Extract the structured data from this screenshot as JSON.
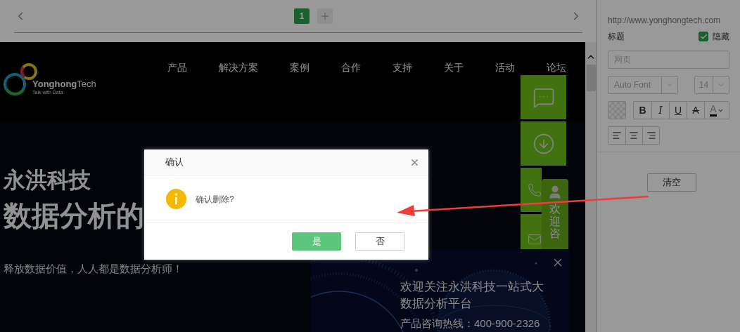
{
  "editor": {
    "page_tabs": [
      {
        "label": "1",
        "selected": true
      }
    ]
  },
  "website": {
    "brand": "**Yonghong**Tech",
    "tagline": "Talk with Data",
    "nav": [
      "产品",
      "解决方案",
      "案例",
      "合作",
      "支持",
      "关于",
      "活动",
      "论坛"
    ],
    "hero": {
      "title": "永洪科技",
      "subtitle": "数据分析的",
      "slogan": "释放数据价值，人人都是数据分析师！"
    },
    "float_tab": "欢迎咨",
    "popup": {
      "headline": "欢迎关注永洪科技一站式大数据分析平台",
      "hotline": "产品咨询热线：400-900-2326"
    }
  },
  "panel": {
    "url": "http://www.yonghongtech.com",
    "title_label": "标题",
    "hide": {
      "label": "隐藏",
      "checked": true
    },
    "title_field": {
      "placeholder": "网页"
    },
    "font": "Auto Font",
    "size": "14",
    "format_buttons": [
      {
        "kind": "bold",
        "label": "B"
      },
      {
        "kind": "italic",
        "label": "I"
      },
      {
        "kind": "underline",
        "label": "U"
      },
      {
        "kind": "strike",
        "label": "A"
      },
      {
        "kind": "color",
        "label": "A"
      }
    ],
    "clear_button": "清空"
  },
  "dialog": {
    "title": "确认",
    "message": "确认删除?",
    "buttons": [
      {
        "label": "是",
        "kind": "primary"
      },
      {
        "label": "否",
        "kind": "default"
      }
    ]
  }
}
